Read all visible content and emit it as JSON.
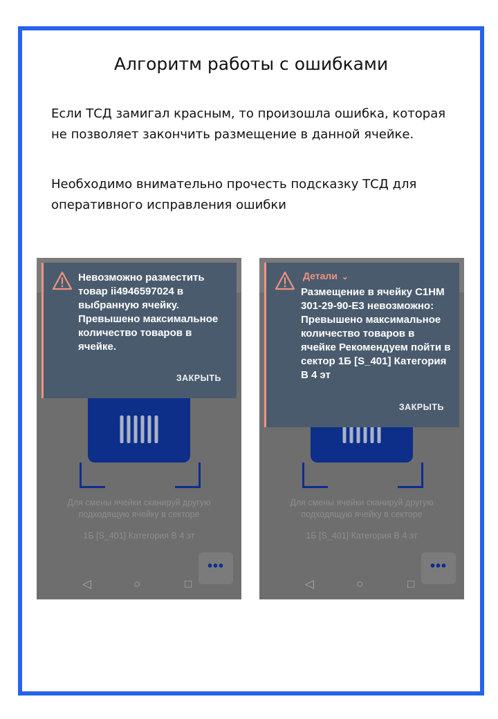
{
  "heading": "Алгоритм работы с ошибками",
  "paragraph1": "Если ТСД замигал красным, то произошла ошибка, которая не позволяет закончить размещение в данной ячейке.",
  "paragraph2": "Необходимо внимательно прочесть подсказку ТСД для оперативного исправления ошибки",
  "colors": {
    "frame": "#2563eb",
    "dialog": "#4a5b6d",
    "accent": "#f29480",
    "card": "#0d2f8a"
  },
  "phones": [
    {
      "dialog_text": "Невозможно разместить товар ii4946597024 в выбранную ячейку. Превышено максимальное количество товаров в ячейке.",
      "close_label": "ЗАКРЫТЬ",
      "hint": "Для смены ячейки сканируй другую подходящую ячейку в секторе",
      "sector": "1Б [S_401] Категория В 4 эт",
      "more_label": "•••",
      "nav_back": "◁",
      "nav_home": "○",
      "nav_recent": "□",
      "warning_icon": "warning-triangle-icon"
    },
    {
      "details_label": "Детали",
      "dialog_text": "Размещение в ячейку C1HM 301-29-90-E3 невозможно: Превышено максимальное количество товаров в ячейке Рекомендуем пойти в сектор 1Б [S_401] Категория В 4 эт",
      "close_label": "ЗАКРЫТЬ",
      "hint": "Для смены ячейки сканируй другую подходящую ячейку в секторе",
      "sector": "1Б [S_401] Категория В 4 эт",
      "more_label": "•••",
      "nav_back": "◁",
      "nav_home": "○",
      "nav_recent": "□",
      "warning_icon": "warning-triangle-icon"
    }
  ]
}
